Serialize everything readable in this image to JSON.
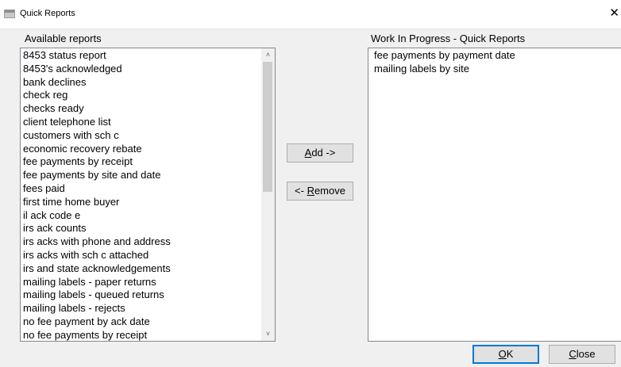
{
  "window": {
    "title": "Quick Reports",
    "close_glyph": "✕"
  },
  "available": {
    "label": "Available reports",
    "items": [
      "8453 status report",
      "8453's acknowledged",
      "bank declines",
      "check reg",
      "checks ready",
      "client telephone list",
      "customers with sch c",
      "economic recovery rebate",
      "fee payments by receipt",
      "fee payments by site and date",
      "fees paid",
      "first time home buyer",
      "il ack code e",
      "irs ack counts",
      "irs acks with phone and address",
      "irs acks with sch c attached",
      "irs and state acknowledgements",
      "mailing labels - paper returns",
      "mailing labels - queued returns",
      "mailing labels - rejects",
      "no fee payment by ack date",
      "no fee payments by receipt"
    ]
  },
  "wip": {
    "label": "Work In Progress - Quick Reports",
    "items": [
      "fee payments by payment date",
      "mailing labels by site"
    ]
  },
  "buttons": {
    "add": {
      "mnemonic": "A",
      "rest": "dd ->"
    },
    "remove": {
      "prefix": "<- ",
      "mnemonic": "R",
      "rest": "emove"
    },
    "ok": {
      "mnemonic": "O",
      "rest": "K"
    },
    "close": {
      "mnemonic": "C",
      "rest": "lose"
    }
  },
  "scrollbar": {
    "up_glyph": "˄",
    "down_glyph": "˅"
  }
}
